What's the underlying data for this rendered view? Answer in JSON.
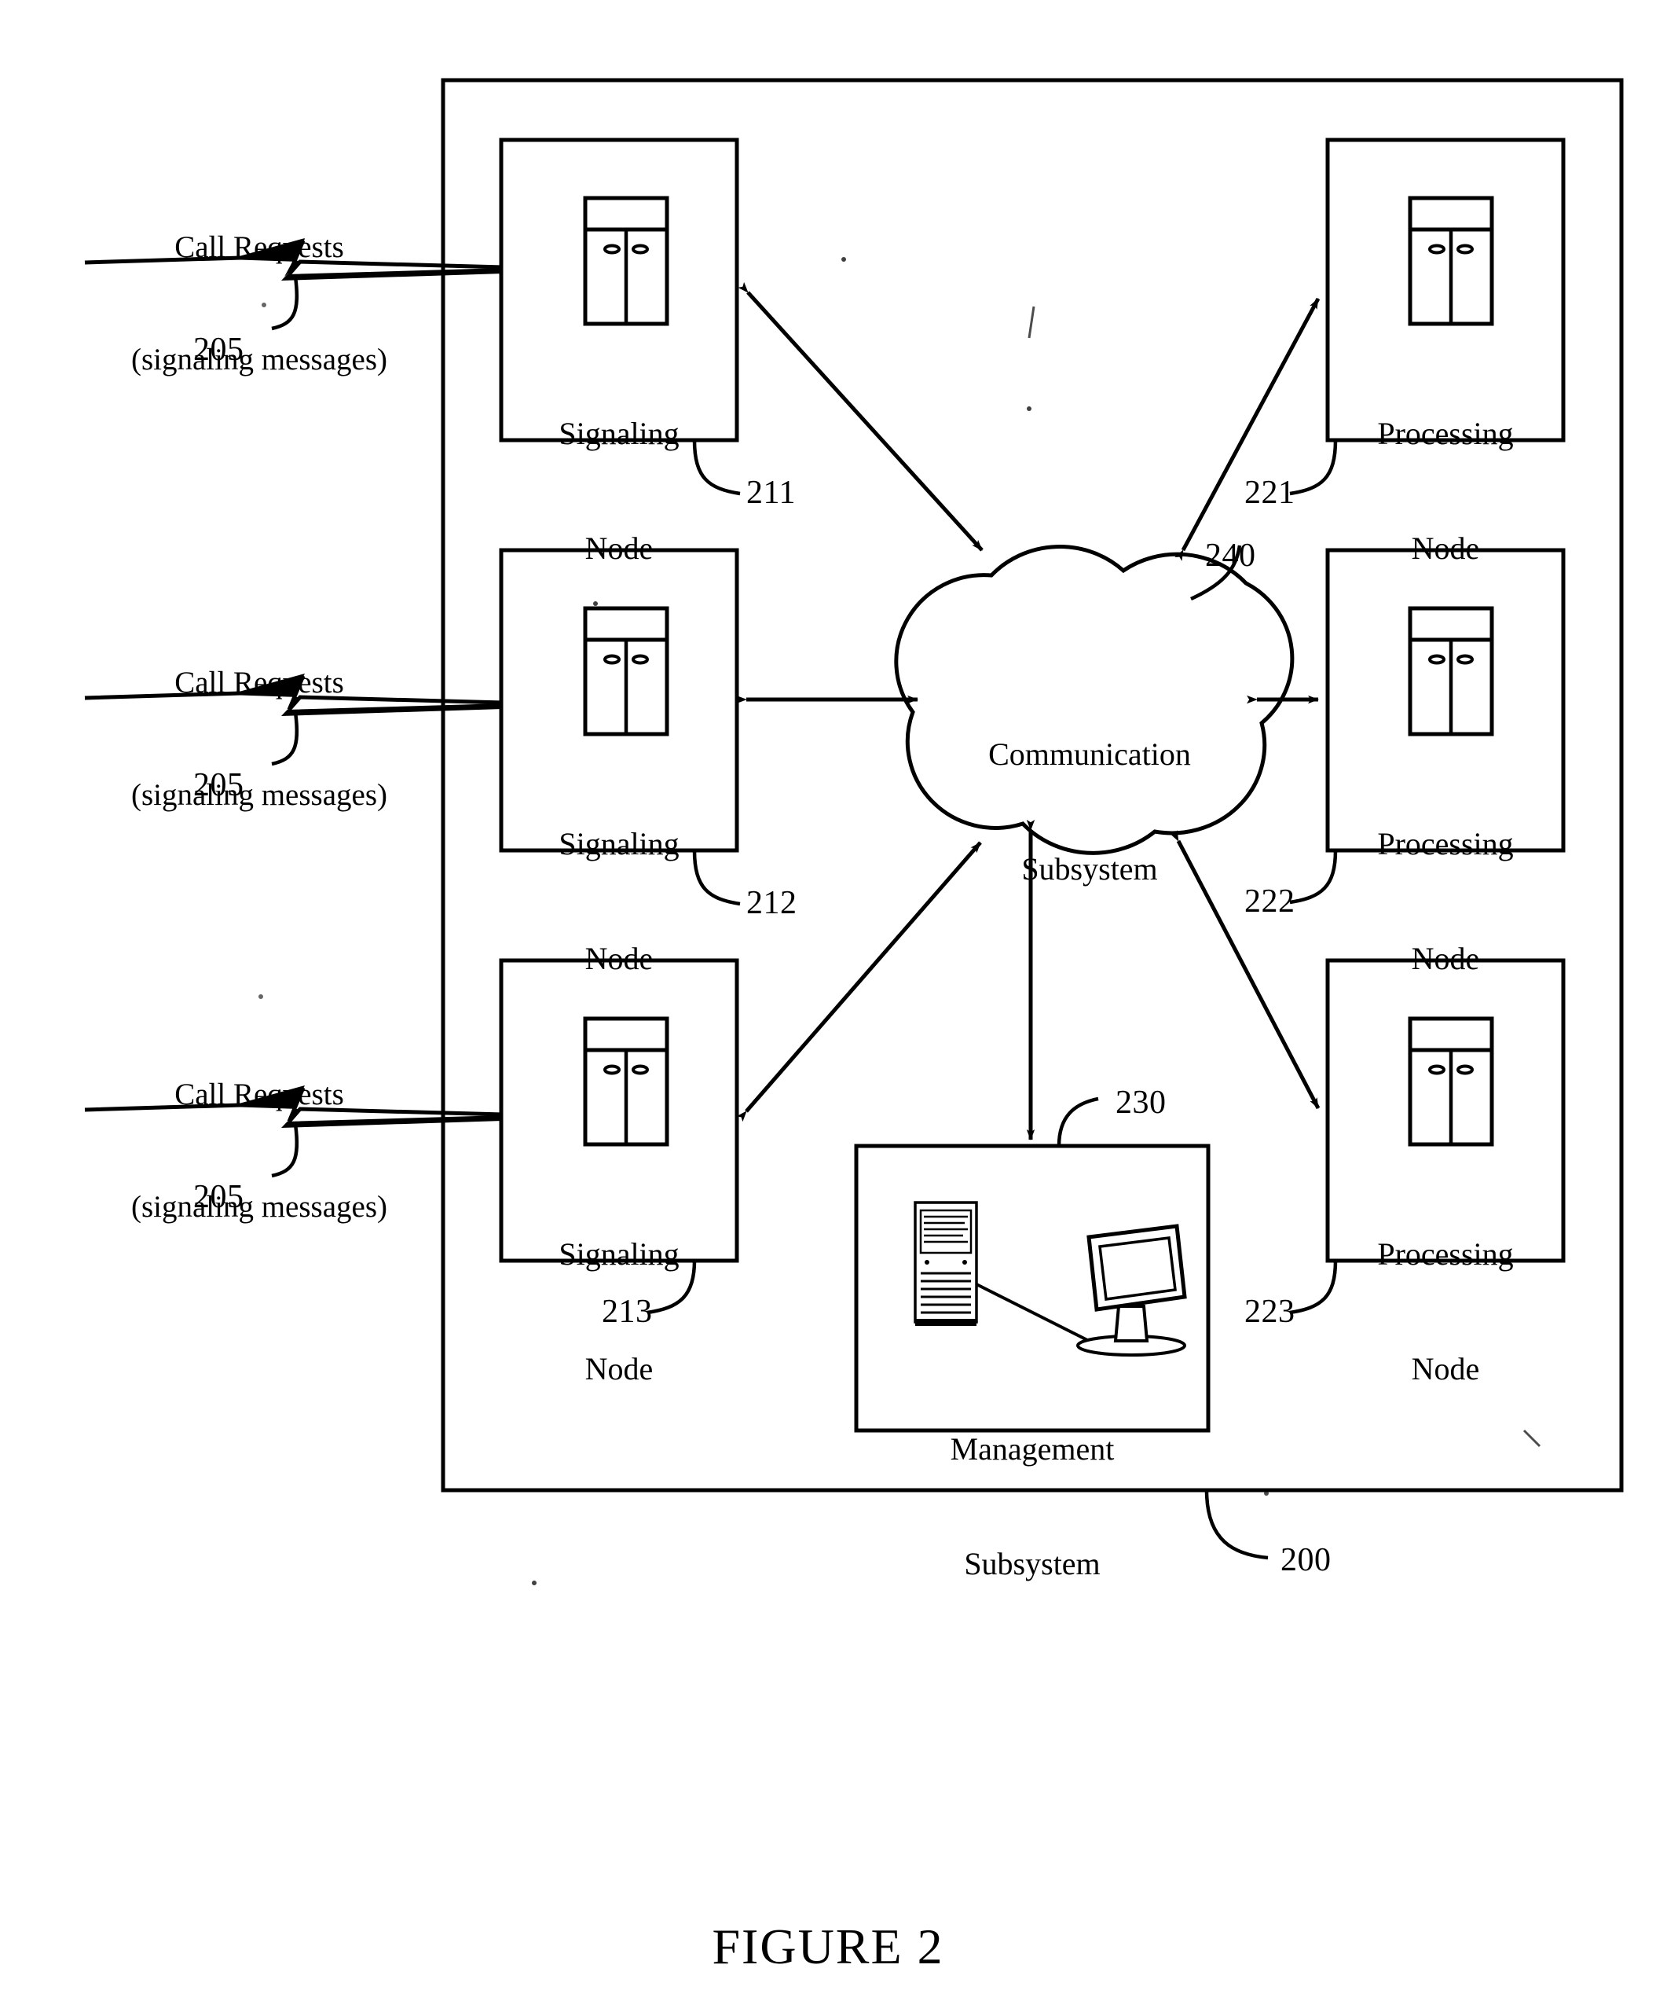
{
  "figure": {
    "caption": "FIGURE 2",
    "system_ref": "200"
  },
  "inputs": [
    {
      "title": "Call Requests",
      "subtitle": "(signaling messages)",
      "ref": "205"
    },
    {
      "title": "Call Requests",
      "subtitle": "(signaling messages)",
      "ref": "205"
    },
    {
      "title": "Call Requests",
      "subtitle": "(signaling messages)",
      "ref": "205"
    }
  ],
  "signaling_nodes": [
    {
      "line1": "Signaling",
      "line2": "Node",
      "ref": "211",
      "icon": "server-cabinet-icon"
    },
    {
      "line1": "Signaling",
      "line2": "Node",
      "ref": "212",
      "icon": "server-cabinet-icon"
    },
    {
      "line1": "Signaling",
      "line2": "Node",
      "ref": "213",
      "icon": "server-cabinet-icon"
    }
  ],
  "processing_nodes": [
    {
      "line1": "Processing",
      "line2": "Node",
      "ref": "221",
      "icon": "server-cabinet-icon"
    },
    {
      "line1": "Processing",
      "line2": "Node",
      "ref": "222",
      "icon": "server-cabinet-icon"
    },
    {
      "line1": "Processing",
      "line2": "Node",
      "ref": "223",
      "icon": "server-cabinet-icon"
    }
  ],
  "communication_subsystem": {
    "line1": "Communication",
    "line2": "Subsystem",
    "ref": "240",
    "shape": "cloud"
  },
  "management_subsystem": {
    "line1": "Management",
    "line2": "Subsystem",
    "ref": "230",
    "icon": "tower-pc-and-monitor-icon"
  },
  "colors": {
    "ink": "#000000",
    "paper": "#ffffff"
  }
}
